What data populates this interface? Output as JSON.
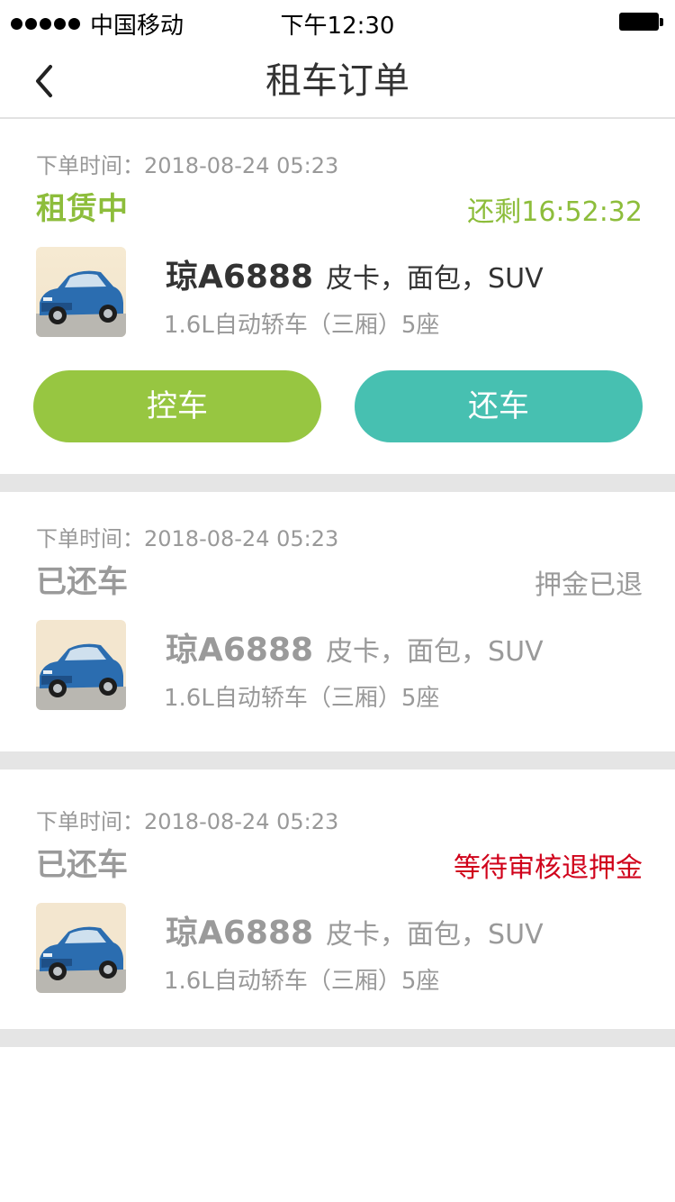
{
  "status_bar": {
    "carrier": "中国移动",
    "time": "下午12:30"
  },
  "nav": {
    "title": "租车订单"
  },
  "colors": {
    "status_active": "#8dbd3b",
    "remaining": "#8dbd3b",
    "status_done": "#9a9a9a",
    "pending_red": "#d0021b",
    "btn_control": "#97c641",
    "btn_return": "#47c0b1",
    "separator": "#e5e5e5"
  },
  "orders": [
    {
      "order_time": "下单时间：2018-08-24  05:23",
      "status": "租赁中",
      "right_text": "还剩16:52:32",
      "plate": "琼A6888",
      "car_type": "皮卡，面包，SUV",
      "spec": "1.6L自动轿车（三厢）5座",
      "buttons": {
        "control": "控车",
        "return": "还车"
      }
    },
    {
      "order_time": "下单时间：2018-08-24  05:23",
      "status": "已还车",
      "right_text": "押金已退",
      "plate": "琼A6888",
      "car_type": "皮卡，面包，SUV",
      "spec": "1.6L自动轿车（三厢）5座"
    },
    {
      "order_time": "下单时间：2018-08-24  05:23",
      "status": "已还车",
      "right_text": "等待审核退押金",
      "plate": "琼A6888",
      "car_type": "皮卡，面包，SUV",
      "spec": "1.6L自动轿车（三厢）5座"
    }
  ]
}
